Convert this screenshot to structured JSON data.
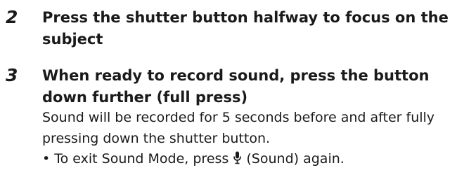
{
  "steps": [
    {
      "number": "2",
      "title": "Press the shutter button halfway to focus on the subject"
    },
    {
      "number": "3",
      "title": "When ready to record sound, press the button down further (full press)",
      "body": "Sound will be recorded for 5 seconds before and after fully pressing down the shutter button.",
      "bullet": {
        "prefix": "• To exit Sound Mode, press ",
        "icon": "microphone-icon",
        "suffix": " (Sound) again."
      }
    }
  ]
}
